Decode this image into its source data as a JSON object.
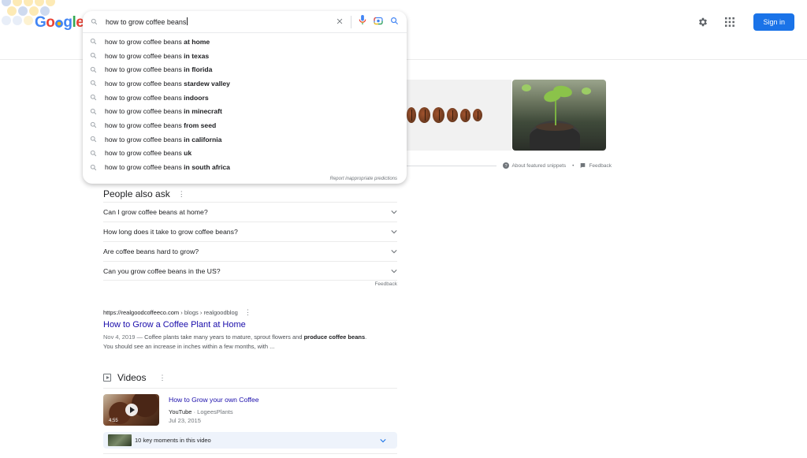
{
  "logo": {
    "text": "Google"
  },
  "search": {
    "query": "how to grow coffee beans",
    "suggestions": [
      {
        "prefix": "how to grow coffee beans",
        "bold": "at home"
      },
      {
        "prefix": "how to grow coffee beans",
        "bold": "in texas"
      },
      {
        "prefix": "how to grow coffee beans",
        "bold": "in florida"
      },
      {
        "prefix": "how to grow coffee beans",
        "bold": "stardew valley"
      },
      {
        "prefix": "how to grow coffee beans",
        "bold": "indoors"
      },
      {
        "prefix": "how to grow coffee beans",
        "bold": "in minecraft"
      },
      {
        "prefix": "how to grow coffee beans",
        "bold": "from seed"
      },
      {
        "prefix": "how to grow coffee beans",
        "bold": "in california"
      },
      {
        "prefix": "how to grow coffee beans",
        "bold": "uk"
      },
      {
        "prefix": "how to grow coffee beans",
        "bold": "in south africa"
      }
    ],
    "report_label": "Report inappropriate predictions",
    "icons": [
      "search-icon",
      "clear-icon",
      "microphone-icon",
      "camera-lens-icon",
      "search-submit-icon"
    ]
  },
  "header": {
    "sign_in_label": "Sign in",
    "icons": [
      "settings-gear-icon",
      "apps-grid-icon"
    ],
    "accent": "#1a73e8"
  },
  "featured_snippet": {
    "about_label": "About featured snippets",
    "separator": "•",
    "feedback_label": "Feedback"
  },
  "people_also_ask": {
    "title": "People also ask",
    "questions": [
      "Can I grow coffee beans at home?",
      "How long does it take to grow coffee beans?",
      "Are coffee beans hard to grow?",
      "Can you grow coffee beans in the US?"
    ],
    "feedback_label": "Feedback"
  },
  "result": {
    "site": "https://realgoodcoffeeco.com",
    "path": "› blogs › realgoodblog",
    "title": "How to Grow a Coffee Plant at Home",
    "date": "Nov 4, 2019 —",
    "desc_1": " Coffee plants take many years to mature, sprout flowers and ",
    "desc_bold_1": "produce coffee beans",
    "desc_2": ". You should see an increase in inches within a few months, with ..."
  },
  "videos": {
    "title": "Videos",
    "items": [
      {
        "title": "How to Grow your own Coffee",
        "source": "YouTube",
        "channel": "· LogeesPlants",
        "date": "Jul 23, 2015",
        "duration": "4:55",
        "key_moments": "10 key moments in this video"
      }
    ]
  }
}
